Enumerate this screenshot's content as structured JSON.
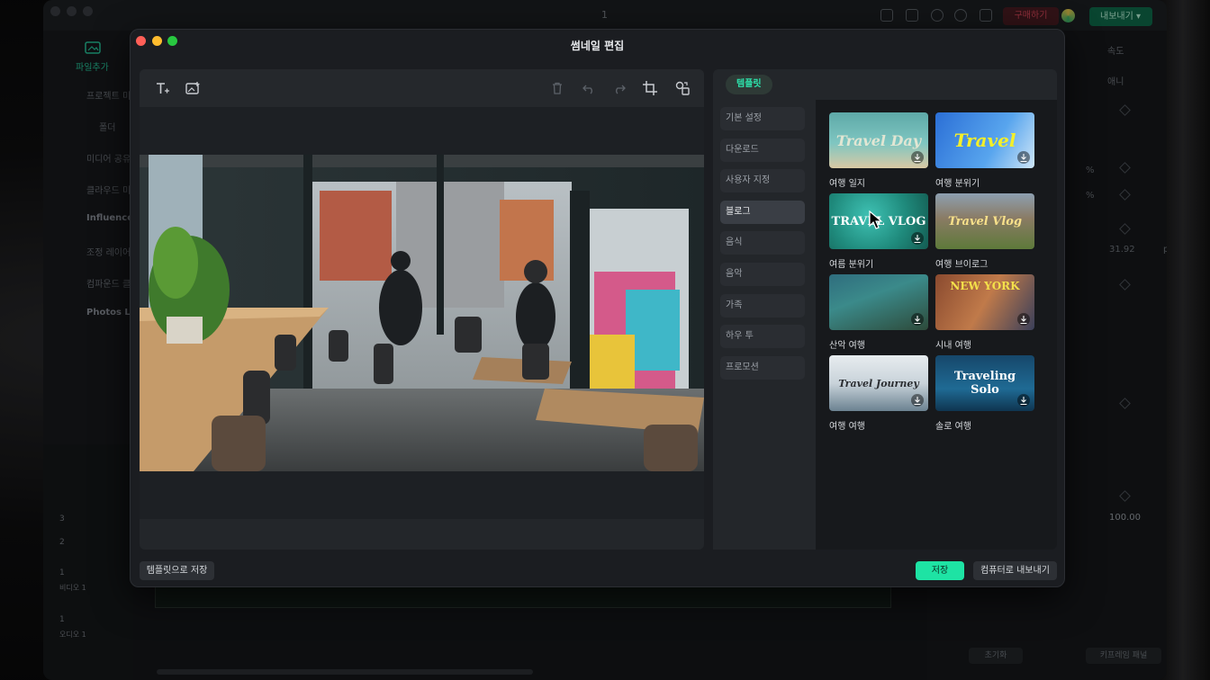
{
  "background_app": {
    "title": "1",
    "buy_label": "구매하기",
    "export_label": "내보내기",
    "import_tab": "파일추가",
    "left_items": [
      "프로젝트 미",
      "폴더",
      "미디어 공유",
      "클라우드 미",
      "Influence",
      "조정 레이어",
      "컴파운드 클",
      "Photos Li"
    ],
    "track_labels": [
      "비디오 1",
      "오디오 1"
    ],
    "track_nums": [
      "3",
      "2",
      "1",
      "1"
    ],
    "right_tab_speed": "속도",
    "right_tab_anim": "애니",
    "right_value_1": "31.92",
    "right_unit": "px",
    "right_pct": "%",
    "right_value_2": "100.00",
    "reset_label": "초기화",
    "keyframe_label": "키프레임 패널"
  },
  "modal": {
    "title": "썸네일 편집",
    "save_as_template": "템플릿으로 저장",
    "save": "저장",
    "export_to_computer": "컴퓨터로 내보내기"
  },
  "toolbar": {
    "tools_left": [
      "text-add-icon",
      "image-add-icon"
    ],
    "tools_right": [
      "trash-icon",
      "undo-icon",
      "redo-icon",
      "crop-icon",
      "swap-icon"
    ]
  },
  "templates": {
    "tab_label": "템플릿",
    "categories": [
      "기본 설정",
      "다운로드",
      "사용자 지정",
      "블로그",
      "음식",
      "음악",
      "가족",
      "하우 투",
      "프로모션"
    ],
    "active_category": "블로그",
    "items": [
      {
        "label": "여행 일지",
        "thumb_text": "Travel Day"
      },
      {
        "label": "여행 분위기",
        "thumb_text": "Travel"
      },
      {
        "label": "여름 분위기",
        "thumb_text": "TRAVEL VLOG"
      },
      {
        "label": "여행 브이로그",
        "thumb_text": "Travel Vlog"
      },
      {
        "label": "산악 여행",
        "thumb_text": ""
      },
      {
        "label": "시내 여행",
        "thumb_text": "NEW YORK"
      },
      {
        "label": "여행 여행",
        "thumb_text": "Travel Journey"
      },
      {
        "label": "솔로 여행",
        "thumb_text": "Traveling Solo"
      }
    ]
  },
  "colors": {
    "accent": "#1ee3a4",
    "modal_bg": "#1b1d21",
    "panel_bg": "#23262a"
  }
}
